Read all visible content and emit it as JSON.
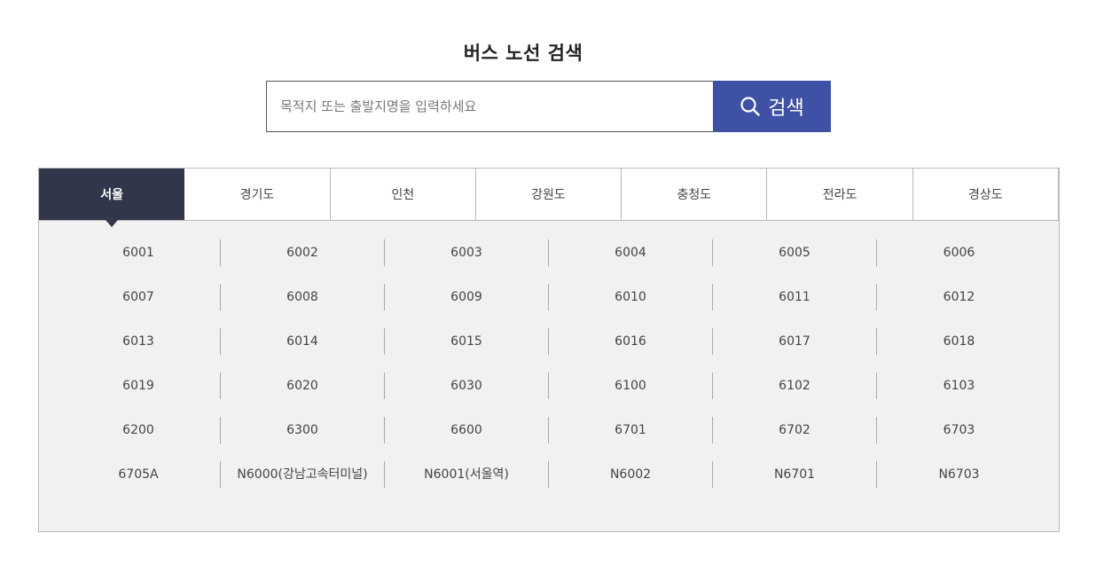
{
  "header": {
    "title": "버스 노선 검색"
  },
  "search": {
    "placeholder": "목적지 또는 출발지명을 입력하세요",
    "value": "",
    "button_label": "검색"
  },
  "tabs": [
    {
      "label": "서울",
      "active": true
    },
    {
      "label": "경기도",
      "active": false
    },
    {
      "label": "인천",
      "active": false
    },
    {
      "label": "강원도",
      "active": false
    },
    {
      "label": "충청도",
      "active": false
    },
    {
      "label": "전라도",
      "active": false
    },
    {
      "label": "경상도",
      "active": false
    }
  ],
  "routes": [
    [
      "6001",
      "6002",
      "6003",
      "6004",
      "6005",
      "6006"
    ],
    [
      "6007",
      "6008",
      "6009",
      "6010",
      "6011",
      "6012"
    ],
    [
      "6013",
      "6014",
      "6015",
      "6016",
      "6017",
      "6018"
    ],
    [
      "6019",
      "6020",
      "6030",
      "6100",
      "6102",
      "6103"
    ],
    [
      "6200",
      "6300",
      "6600",
      "6701",
      "6702",
      "6703"
    ],
    [
      "6705A",
      "N6000(강남고속터미널)",
      "N6001(서울역)",
      "N6002",
      "N6701",
      "N6703"
    ]
  ],
  "colors": {
    "accent": "#3f51a5",
    "active_tab": "#32364b",
    "panel_bg": "#f1f1f1"
  }
}
